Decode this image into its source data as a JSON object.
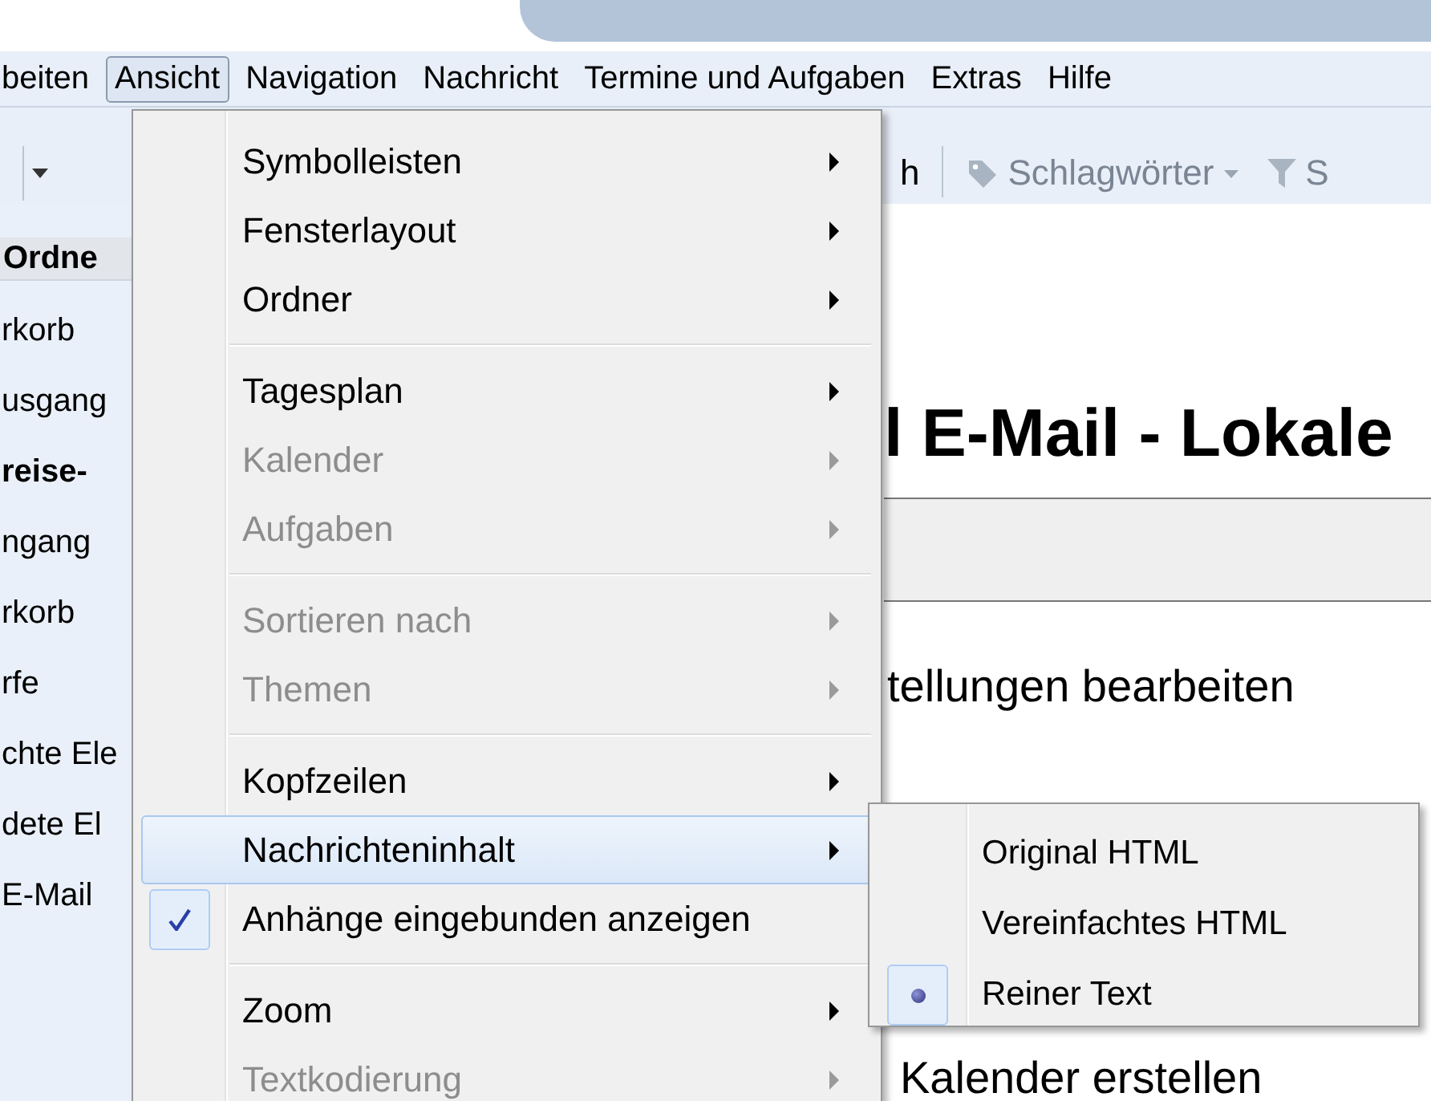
{
  "menubar": [
    {
      "label": "beiten",
      "selected": false
    },
    {
      "label": "Ansicht",
      "selected": true
    },
    {
      "label": "Navigation",
      "selected": false
    },
    {
      "label": "Nachricht",
      "selected": false
    },
    {
      "label": "Termine und Aufgaben",
      "selected": false
    },
    {
      "label": "Extras",
      "selected": false
    },
    {
      "label": "Hilfe",
      "selected": false
    }
  ],
  "toolbar": {
    "partial_label": "h",
    "tags_button": "Schlagwörter",
    "filter_button": "S"
  },
  "folder_pane": {
    "header": "Ordne",
    "items": [
      {
        "label": "rkorb",
        "bold": false
      },
      {
        "label": "usgang",
        "bold": false
      },
      {
        "label": "reise-",
        "bold": true
      },
      {
        "label": "ngang",
        "bold": false
      },
      {
        "label": "rkorb",
        "bold": false
      },
      {
        "label": "rfe",
        "bold": false
      },
      {
        "label": "chte Ele",
        "bold": false
      },
      {
        "label": "dete El",
        "bold": false
      },
      {
        "label": "E-Mail",
        "bold": false
      }
    ]
  },
  "content": {
    "heading": "l E-Mail - Lokale",
    "link_1": "tellungen bearbeiten",
    "link_2": "Kalender erstellen"
  },
  "view_menu": [
    {
      "kind": "item",
      "label": "Symbolleisten",
      "disabled": false,
      "selected": false,
      "checked": false,
      "submenu": true
    },
    {
      "kind": "item",
      "label": "Fensterlayout",
      "disabled": false,
      "selected": false,
      "checked": false,
      "submenu": true
    },
    {
      "kind": "item",
      "label": "Ordner",
      "disabled": false,
      "selected": false,
      "checked": false,
      "submenu": true
    },
    {
      "kind": "separator"
    },
    {
      "kind": "item",
      "label": "Tagesplan",
      "disabled": false,
      "selected": false,
      "checked": false,
      "submenu": true
    },
    {
      "kind": "item",
      "label": "Kalender",
      "disabled": true,
      "selected": false,
      "checked": false,
      "submenu": true
    },
    {
      "kind": "item",
      "label": "Aufgaben",
      "disabled": true,
      "selected": false,
      "checked": false,
      "submenu": true
    },
    {
      "kind": "separator"
    },
    {
      "kind": "item",
      "label": "Sortieren nach",
      "disabled": true,
      "selected": false,
      "checked": false,
      "submenu": true
    },
    {
      "kind": "item",
      "label": "Themen",
      "disabled": true,
      "selected": false,
      "checked": false,
      "submenu": true
    },
    {
      "kind": "separator"
    },
    {
      "kind": "item",
      "label": "Kopfzeilen",
      "disabled": false,
      "selected": false,
      "checked": false,
      "submenu": true
    },
    {
      "kind": "item",
      "label": "Nachrichteninhalt",
      "disabled": false,
      "selected": true,
      "checked": false,
      "submenu": true
    },
    {
      "kind": "item",
      "label": "Anhänge eingebunden anzeigen",
      "disabled": false,
      "selected": false,
      "checked": true,
      "submenu": false
    },
    {
      "kind": "separator"
    },
    {
      "kind": "item",
      "label": "Zoom",
      "disabled": false,
      "selected": false,
      "checked": false,
      "submenu": true
    },
    {
      "kind": "item",
      "label": "Textkodierung",
      "disabled": true,
      "selected": false,
      "checked": false,
      "submenu": true
    }
  ],
  "message_body_submenu": [
    {
      "label": "Original HTML",
      "selected": false
    },
    {
      "label": "Vereinfachtes HTML",
      "selected": false
    },
    {
      "label": "Reiner Text",
      "selected": true
    }
  ]
}
